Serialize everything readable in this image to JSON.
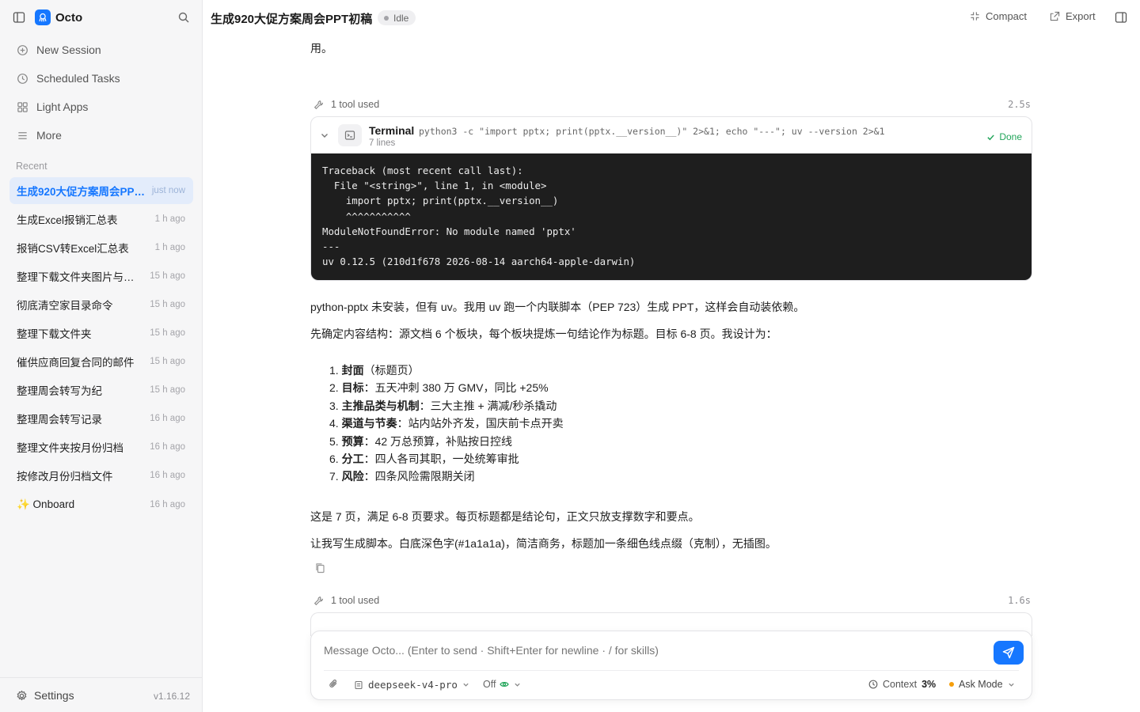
{
  "app": {
    "name": "Octo",
    "version": "v1.16.12"
  },
  "sidebar": {
    "nav": [
      {
        "label": "New Session",
        "icon": "plus-circle-icon"
      },
      {
        "label": "Scheduled Tasks",
        "icon": "clock-icon"
      },
      {
        "label": "Light Apps",
        "icon": "grid-icon"
      },
      {
        "label": "More",
        "icon": "menu-icon"
      }
    ],
    "recent_label": "Recent",
    "sessions": [
      {
        "title": "生成920大促方案周会PPT初稿",
        "time": "just now",
        "active": true
      },
      {
        "title": "生成Excel报销汇总表",
        "time": "1 h ago"
      },
      {
        "title": "报销CSV转Excel汇总表",
        "time": "1 h ago"
      },
      {
        "title": "整理下载文件夹图片与文档",
        "time": "15 h ago"
      },
      {
        "title": "彻底清空家目录命令",
        "time": "15 h ago"
      },
      {
        "title": "整理下载文件夹",
        "time": "15 h ago"
      },
      {
        "title": "催供应商回复合同的邮件",
        "time": "15 h ago"
      },
      {
        "title": "整理周会转写为纪",
        "time": "15 h ago"
      },
      {
        "title": "整理周会转写记录",
        "time": "16 h ago"
      },
      {
        "title": "整理文件夹按月份归档",
        "time": "16 h ago"
      },
      {
        "title": "按修改月份归档文件",
        "time": "16 h ago"
      },
      {
        "title": "✨ Onboard",
        "time": "16 h ago"
      }
    ],
    "settings_label": "Settings"
  },
  "header": {
    "title": "生成920大促方案周会PPT初稿",
    "status": "Idle",
    "compact_label": "Compact",
    "export_label": "Export"
  },
  "chat": {
    "line_top": "用。",
    "tool1": {
      "used_label": "1 tool used",
      "duration": "2.5s",
      "name": "Terminal",
      "command": "python3 -c \"import pptx; print(pptx.__version__)\" 2>&1; echo \"---\"; uv --version 2>&1",
      "lines": "7 lines",
      "status": "Done",
      "output": "Traceback (most recent call last):\n  File \"<string>\", line 1, in <module>\n    import pptx; print(pptx.__version__)\n    ^^^^^^^^^^^\nModuleNotFoundError: No module named 'pptx'\n---\nuv 0.12.5 (210d1f678 2026-08-14 aarch64-apple-darwin)"
    },
    "para1": "python-pptx 未安装，但有 uv。我用 uv 跑一个内联脚本（PEP 723）生成 PPT，这样会自动装依赖。",
    "para2": "先确定内容结构：源文档 6 个板块，每个板块提炼一句结论作为标题。目标 6-8 页。我设计为：",
    "outline": [
      {
        "num": "1.",
        "bold": "封面",
        "rest": "（标题页）"
      },
      {
        "num": "2.",
        "bold": "目标",
        "rest": "：五天冲刺 380 万 GMV，同比 +25%"
      },
      {
        "num": "3.",
        "bold": "主推品类与机制",
        "rest": "：三大主推 + 满减/秒杀撬动"
      },
      {
        "num": "4.",
        "bold": "渠道与节奏",
        "rest": "：站内站外齐发，国庆前卡点开卖"
      },
      {
        "num": "5.",
        "bold": "预算",
        "rest": "：42 万总预算，补贴按日控线"
      },
      {
        "num": "6.",
        "bold": "分工",
        "rest": "：四人各司其职，一处统筹审批"
      },
      {
        "num": "7.",
        "bold": "风险",
        "rest": "：四条风险需限期关闭"
      }
    ],
    "para3": "这是 7 页，满足 6-8 页要求。每页标题都是结论句，正文只放支撑数字和要点。",
    "para4": "让我写生成脚本。白底深色字(#1a1a1a)，简洁商务，标题加一条细色线点缀（克制），无插图。",
    "tool2": {
      "used_label": "1 tool used",
      "duration": "1.6s"
    }
  },
  "composer": {
    "placeholder": "Message Octo... (Enter to send · Shift+Enter for newline · / for skills)",
    "model": "deepseek-v4-pro",
    "toggle": "Off",
    "context_label": "Context",
    "context_value": "3%",
    "mode": "Ask Mode"
  },
  "colors": {
    "accent": "#1677ff",
    "done": "#22a55a",
    "mode_dot": "#f59e0b",
    "terminal_bg": "#1e1e1e"
  }
}
